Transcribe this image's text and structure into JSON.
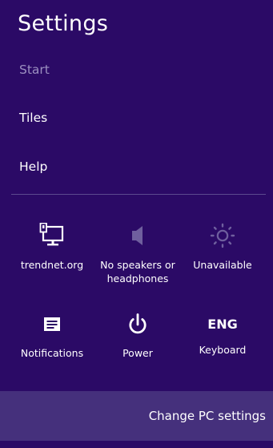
{
  "panel": {
    "title": "Settings",
    "background_color": "#2b0a66",
    "footer_color": "#45307c"
  },
  "menu": {
    "start": "Start",
    "tiles": "Tiles",
    "help": "Help"
  },
  "quick_settings": {
    "network": {
      "label": "trendnet.org",
      "icon": "network-monitor-icon"
    },
    "volume": {
      "label": "No speakers or headphones",
      "icon": "speaker-icon",
      "state": "disabled"
    },
    "brightness": {
      "label": "Unavailable",
      "icon": "brightness-sun-icon",
      "state": "disabled"
    },
    "notifications": {
      "label": "Notifications",
      "icon": "notifications-icon"
    },
    "power": {
      "label": "Power",
      "icon": "power-icon"
    },
    "keyboard": {
      "label": "Keyboard",
      "indicator": "ENG"
    }
  },
  "footer": {
    "change_pc_settings": "Change PC settings"
  }
}
